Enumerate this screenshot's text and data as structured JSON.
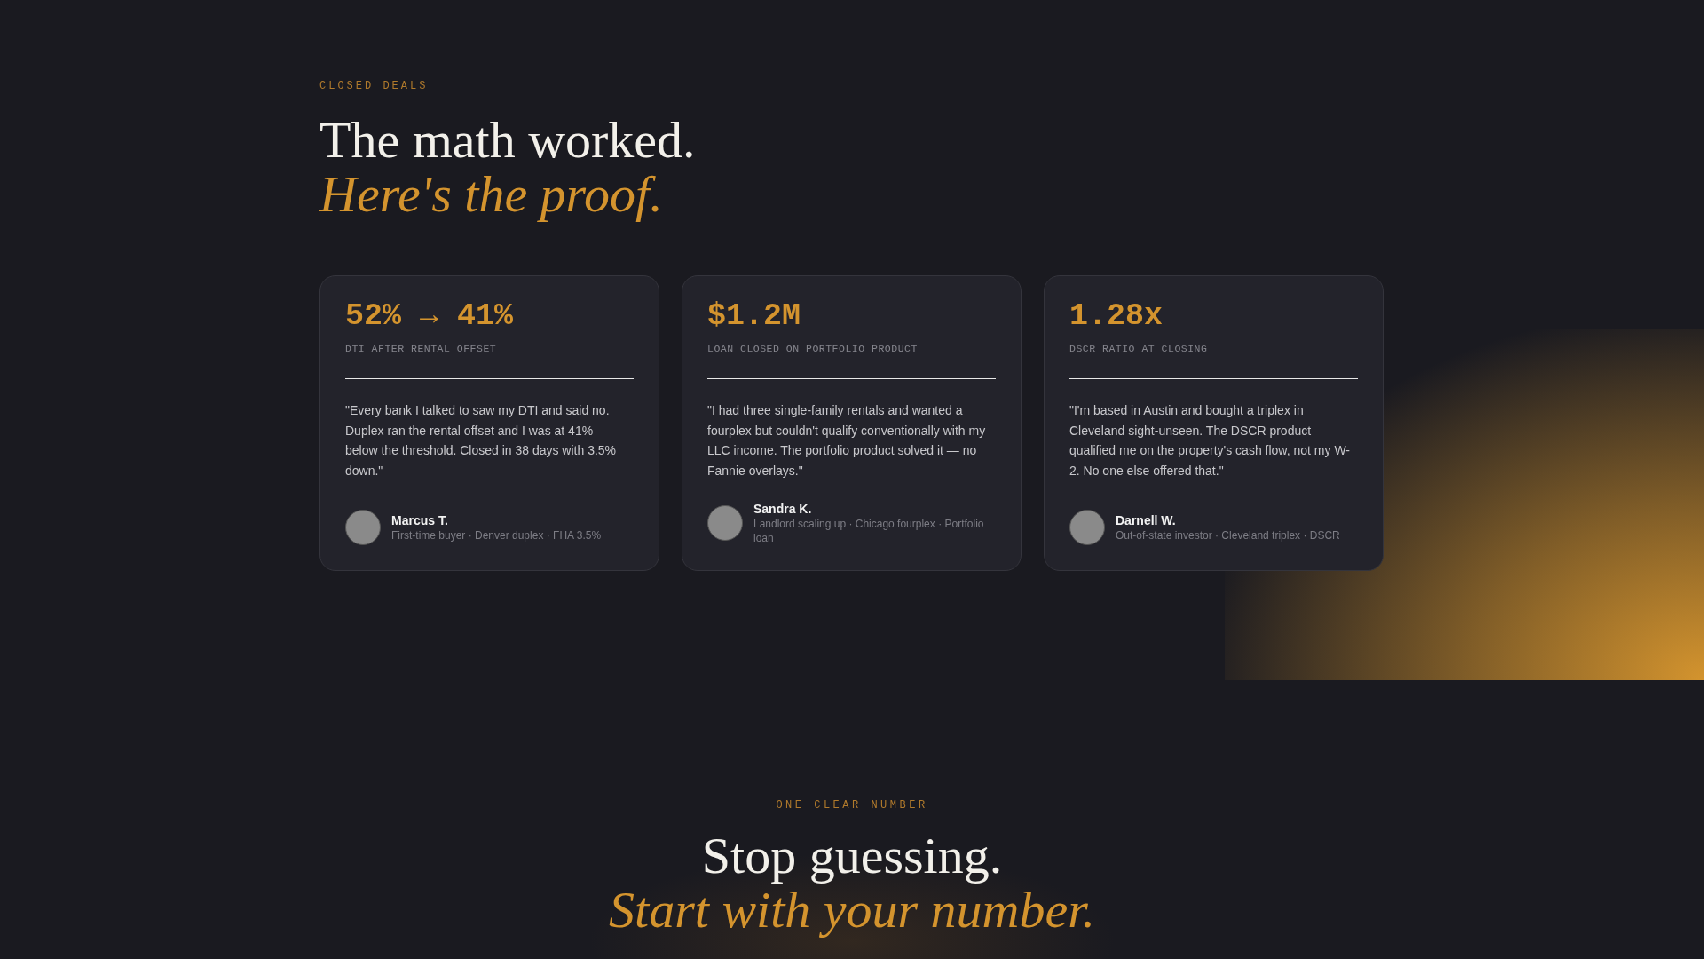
{
  "deals_section": {
    "eyebrow": "CLOSED DEALS",
    "heading": "The math worked.",
    "heading_accent": "Here's the proof.",
    "cards": [
      {
        "stat": "52% → 41%",
        "stat_label": "DTI AFTER RENTAL OFFSET",
        "quote": "\"Every bank I talked to saw my DTI and said no. Duplex ran the rental offset and I was at 41% — below the threshold. Closed in 38 days with 3.5% down.\"",
        "name": "Marcus T.",
        "detail": "First-time buyer · Denver duplex · FHA 3.5%"
      },
      {
        "stat": "$1.2M",
        "stat_label": "LOAN CLOSED ON PORTFOLIO PRODUCT",
        "quote": "\"I had three single-family rentals and wanted a fourplex but couldn't qualify conventionally with my LLC income. The portfolio product solved it — no Fannie overlays.\"",
        "name": "Sandra K.",
        "detail": "Landlord scaling up · Chicago fourplex · Portfolio loan"
      },
      {
        "stat": "1.28x",
        "stat_label": "DSCR RATIO AT CLOSING",
        "quote": "\"I'm based in Austin and bought a triplex in Cleveland sight-unseen. The DSCR product qualified me on the property's cash flow, not my W-2. No one else offered that.\"",
        "name": "Darnell W.",
        "detail": "Out-of-state investor · Cleveland triplex · DSCR"
      }
    ]
  },
  "number_section": {
    "eyebrow": "ONE CLEAR NUMBER",
    "heading": "Stop guessing.",
    "heading_accent": "Start with your number."
  }
}
